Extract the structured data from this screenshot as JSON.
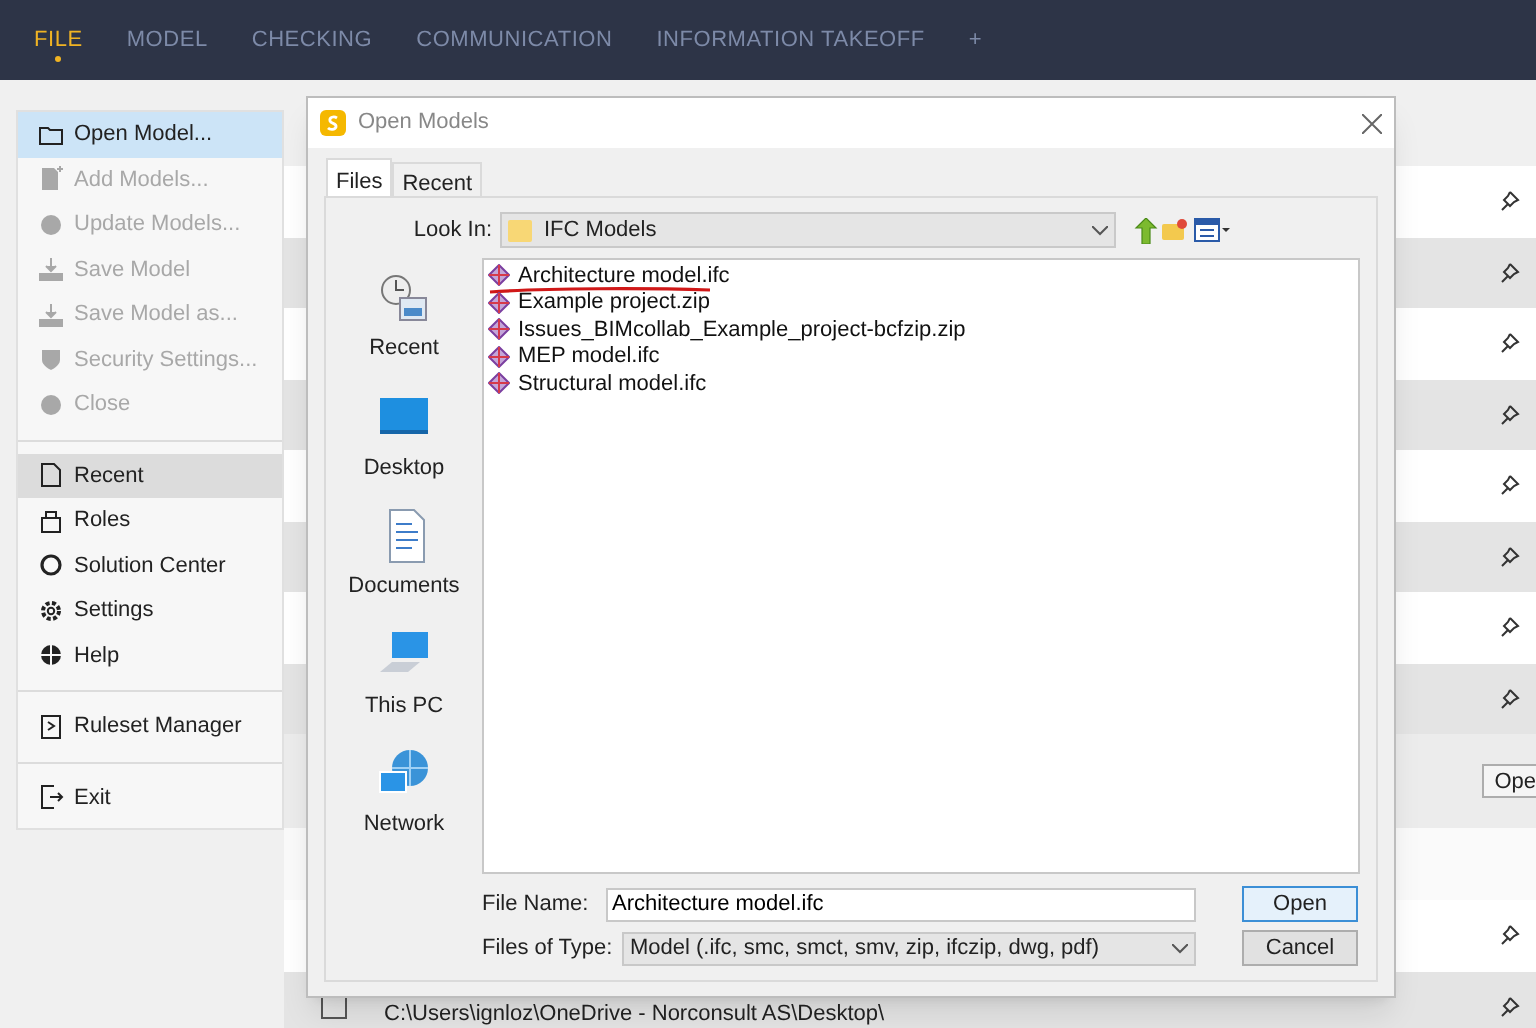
{
  "top_tabs": [
    {
      "label": "FILE",
      "selected": true
    },
    {
      "label": "MODEL",
      "selected": false
    },
    {
      "label": "CHECKING",
      "selected": false
    },
    {
      "label": "COMMUNICATION",
      "selected": false
    },
    {
      "label": "INFORMATION TAKEOFF",
      "selected": false
    },
    {
      "label": "+",
      "selected": false
    }
  ],
  "file_menu": {
    "groups": [
      [
        {
          "label": "Open Model...",
          "disabled": false,
          "highlighted": true,
          "selected": false
        },
        {
          "label": "Add Models...",
          "disabled": true,
          "highlighted": false,
          "selected": false
        },
        {
          "label": "Update Models...",
          "disabled": true,
          "highlighted": false,
          "selected": false
        },
        {
          "label": "Save Model",
          "disabled": true,
          "highlighted": false,
          "selected": false
        },
        {
          "label": "Save Model as...",
          "disabled": true,
          "highlighted": false,
          "selected": false
        },
        {
          "label": "Security Settings...",
          "disabled": true,
          "highlighted": false,
          "selected": false
        },
        {
          "label": "Close",
          "disabled": true,
          "highlighted": false,
          "selected": false
        }
      ],
      [
        {
          "label": "Recent",
          "disabled": false,
          "highlighted": false,
          "selected": true
        },
        {
          "label": "Roles",
          "disabled": false,
          "highlighted": false,
          "selected": false
        },
        {
          "label": "Solution Center",
          "disabled": false,
          "highlighted": false,
          "selected": false
        },
        {
          "label": "Settings",
          "disabled": false,
          "highlighted": false,
          "selected": false
        },
        {
          "label": "Help",
          "disabled": false,
          "highlighted": false,
          "selected": false
        }
      ],
      [
        {
          "label": "Ruleset Manager",
          "disabled": false,
          "highlighted": false,
          "selected": false
        }
      ],
      [
        {
          "label": "Exit",
          "disabled": false,
          "highlighted": false,
          "selected": false
        }
      ]
    ]
  },
  "recent_rows": [
    {
      "kind": "pin"
    },
    {
      "kind": "pin"
    },
    {
      "kind": "pin"
    },
    {
      "kind": "pin"
    },
    {
      "kind": "pin"
    },
    {
      "kind": "pin"
    },
    {
      "kind": "pin"
    },
    {
      "kind": "pin"
    },
    {
      "kind": "button",
      "label": "Ope"
    },
    {
      "kind": "blank"
    },
    {
      "kind": "pin"
    },
    {
      "kind": "pin"
    }
  ],
  "recent_path": "C:\\Users\\ignloz\\OneDrive - Norconsult AS\\Desktop\\",
  "dialog": {
    "title": "Open Models",
    "tabs": [
      {
        "label": "Files",
        "selected": true
      },
      {
        "label": "Recent",
        "selected": false
      }
    ],
    "look_in": {
      "label": "Look In:",
      "value": "IFC Models"
    },
    "places": [
      "Recent",
      "Desktop",
      "Documents",
      "This PC",
      "Network"
    ],
    "files": [
      {
        "name": "Architecture model.ifc",
        "underlined": true
      },
      {
        "name": "Example project.zip",
        "underlined": false
      },
      {
        "name": "Issues_BIMcollab_Example_project-bcfzip.zip",
        "underlined": false
      },
      {
        "name": "MEP model.ifc",
        "underlined": false
      },
      {
        "name": "Structural model.ifc",
        "underlined": false
      }
    ],
    "file_name": {
      "label": "File Name:",
      "value": "Architecture model.ifc"
    },
    "file_type": {
      "label": "Files of Type:",
      "value": "Model (.ifc, smc, smct, smv, zip, ifczip, dwg, pdf)"
    },
    "buttons": [
      "Open",
      "Cancel"
    ]
  }
}
